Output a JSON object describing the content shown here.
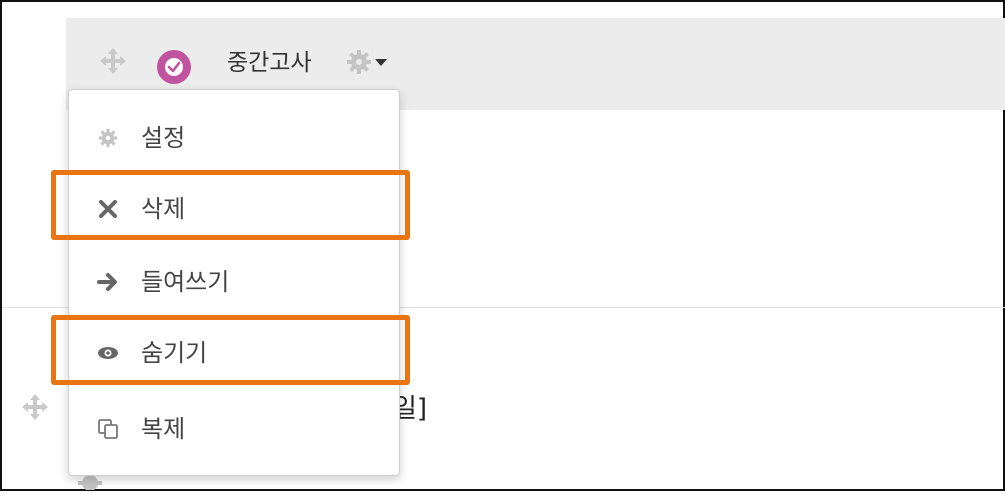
{
  "activity": {
    "title": "중간고사",
    "move_icon": "move-icon",
    "type_icon": "quiz-check-icon",
    "accent_color": "#c1549f",
    "menu_toggle_icon": "gear-icon"
  },
  "menu": {
    "items": [
      {
        "icon": "gear-icon",
        "label": "설정"
      },
      {
        "icon": "close-icon",
        "label": "삭제",
        "highlighted": true
      },
      {
        "icon": "arrow-right-icon",
        "label": "들여쓰기"
      },
      {
        "icon": "eye-icon",
        "label": "숨기기",
        "highlighted": true
      },
      {
        "icon": "duplicate-icon",
        "label": "복제"
      }
    ]
  },
  "below_activity": {
    "partial_text": "일]"
  },
  "colors": {
    "highlight": "#e87511",
    "header_bg": "#ececec"
  }
}
